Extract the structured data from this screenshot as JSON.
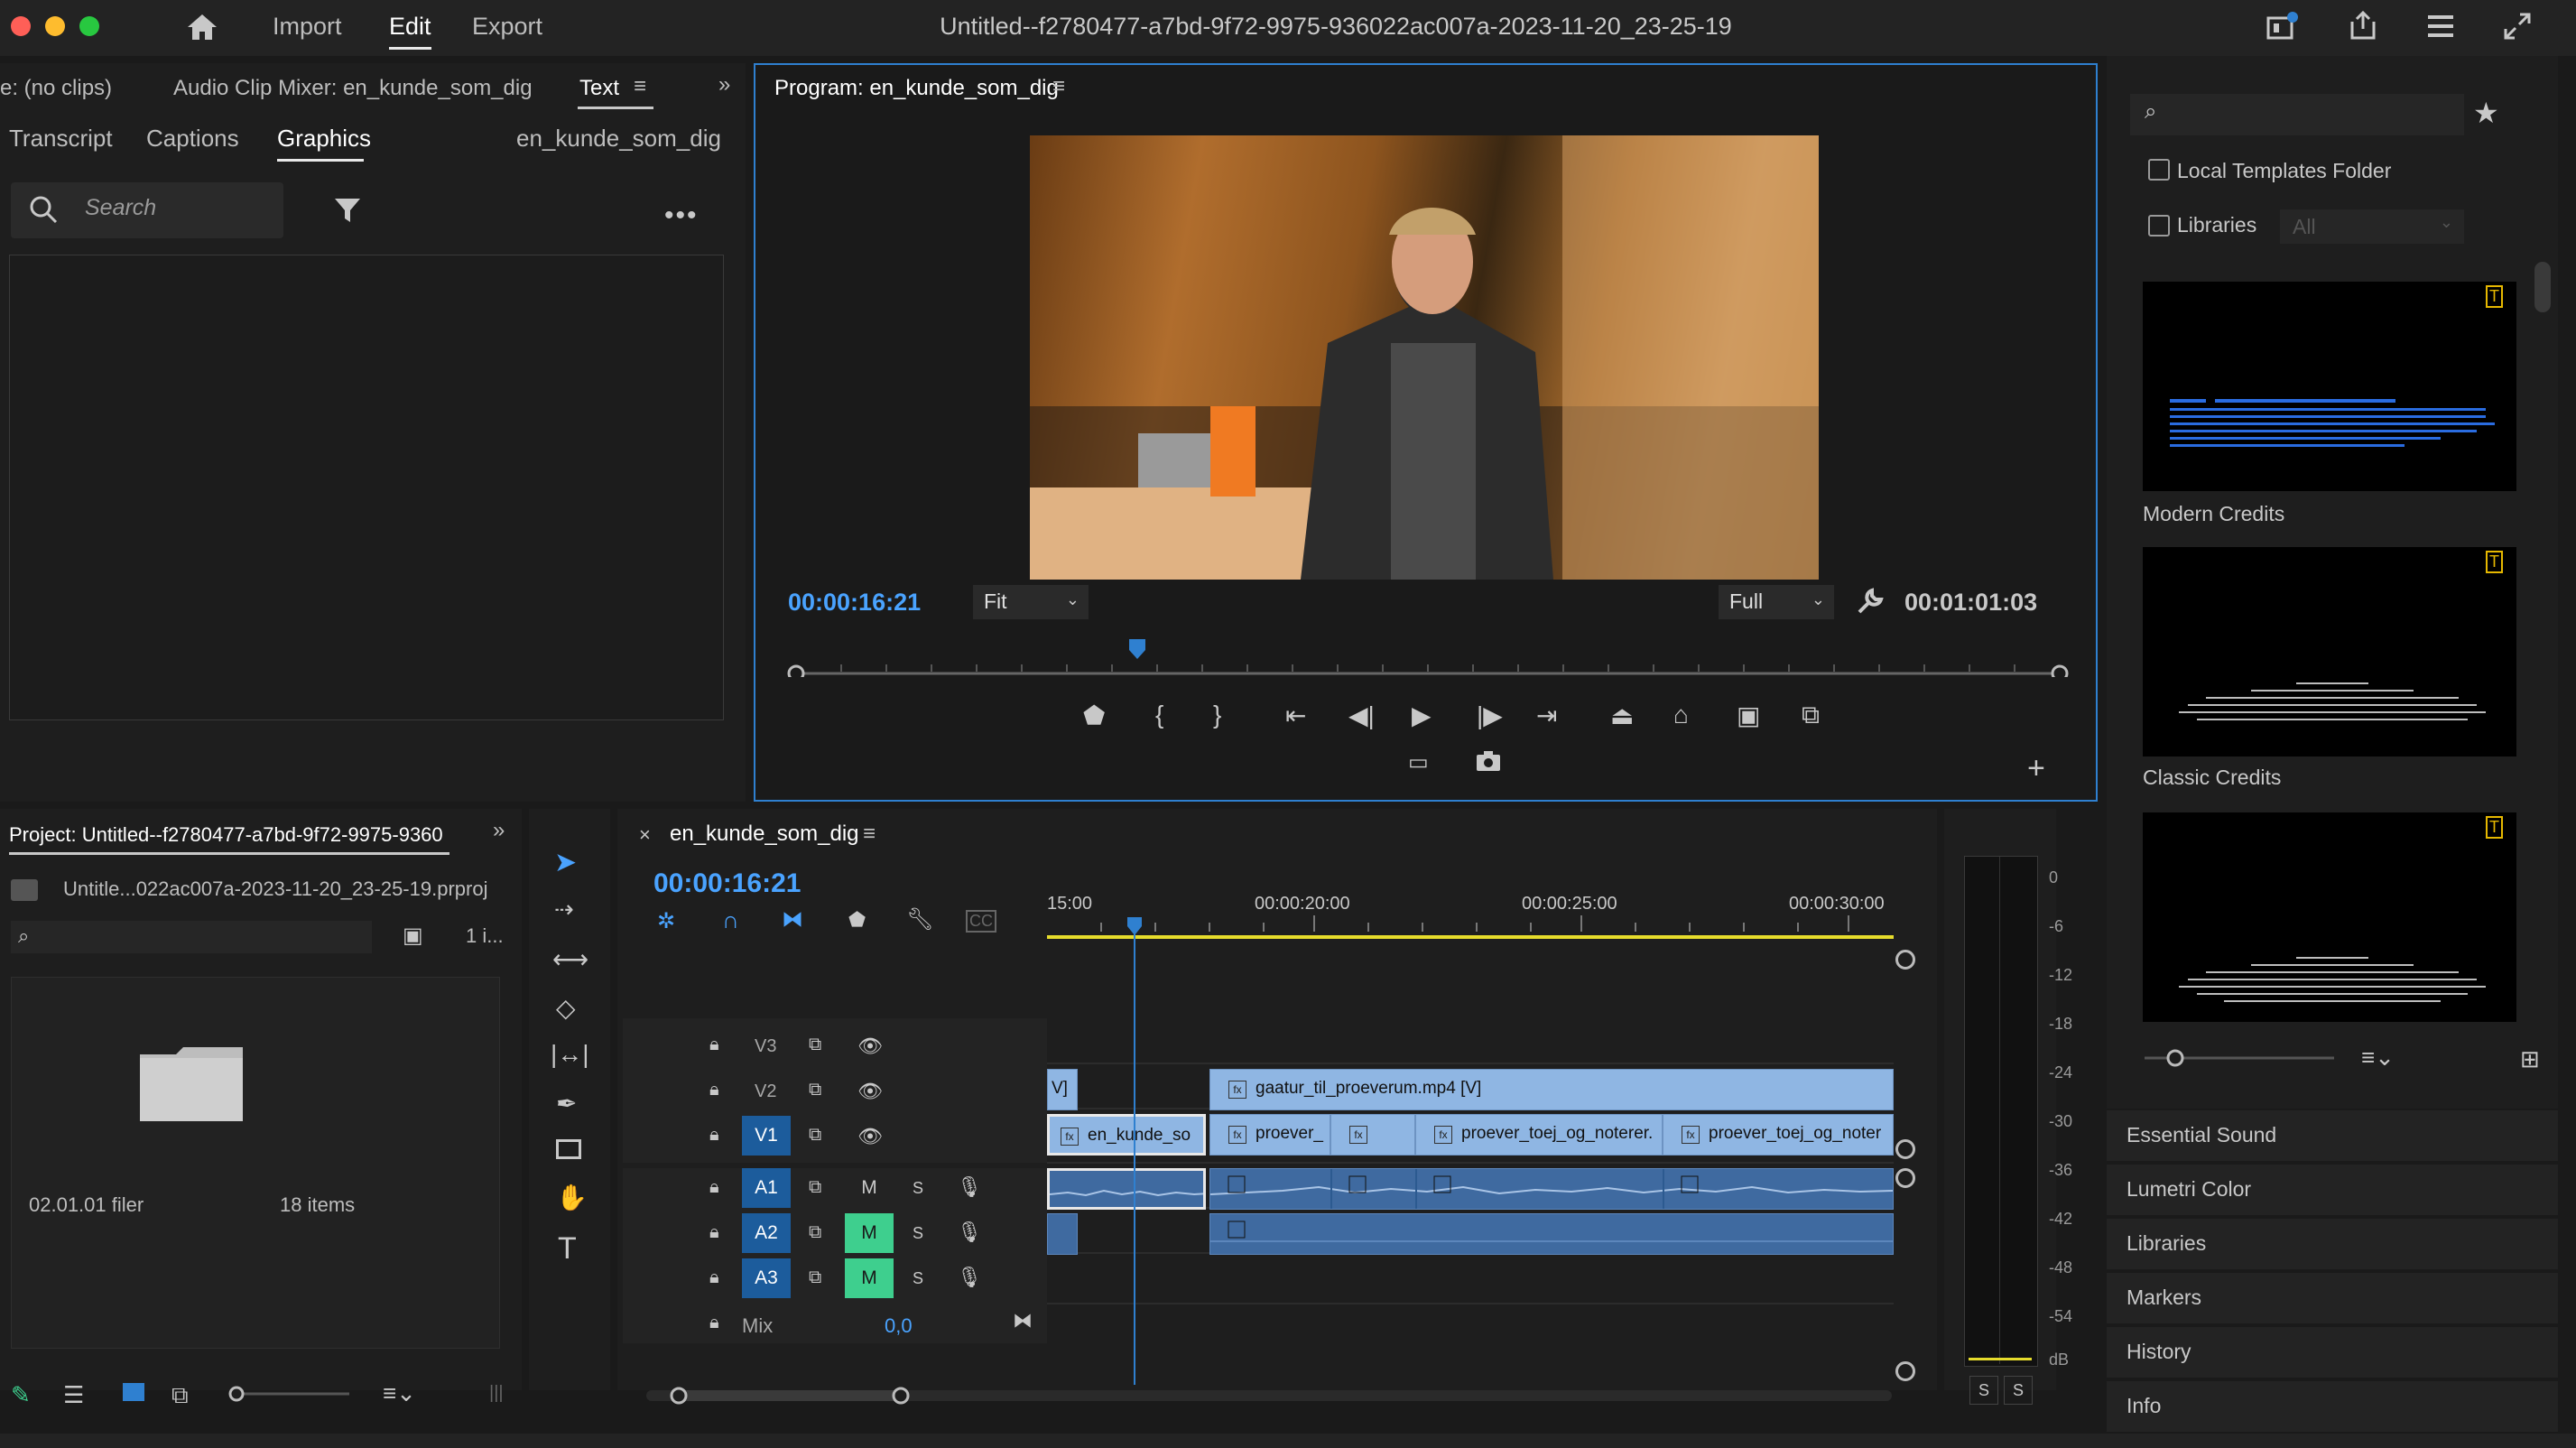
{
  "topbar": {
    "home_icon": "home-icon",
    "nav": [
      "Import",
      "Edit",
      "Export"
    ],
    "title": "Untitled--f2780477-a7bd-9f72-9975-936022ac007a-2023-11-20_23-25-19"
  },
  "left_panel": {
    "tabs": [
      "e: (no clips)",
      "Audio Clip Mixer: en_kunde_som_dig",
      "Text"
    ],
    "subtabs": [
      "Transcript",
      "Captions",
      "Graphics"
    ],
    "sequence_label": "en_kunde_som_dig",
    "search_placeholder": "Search"
  },
  "program_monitor": {
    "title": "Program: en_kunde_som_dig",
    "current_time": "00:00:16:21",
    "fit": "Fit",
    "quality": "Full",
    "duration": "00:01:01:03",
    "playhead_fraction": 0.27
  },
  "project": {
    "title": "Project: Untitled--f2780477-a7bd-9f72-9975-9360",
    "file": "Untitle...022ac007a-2023-11-20_23-25-19.prproj",
    "count_label": "1 i...",
    "bin_name": "02.01.01 filer",
    "bin_items": "18 items"
  },
  "timeline": {
    "sequence_name": "en_kunde_som_dig",
    "timecode": "00:00:16:21",
    "ruler": [
      "15:00",
      "00:00:20:00",
      "00:00:25:00",
      "00:00:30:00"
    ],
    "tracks_video": [
      "V3",
      "V2",
      "V1"
    ],
    "tracks_audio": [
      "A1",
      "A2",
      "A3"
    ],
    "mix_label": "Mix",
    "mix_value": "0,0",
    "clips": {
      "v2_left": "V]",
      "v2_main": "gaatur_til_proeverum.mp4 [V]",
      "v1_1": "en_kunde_so",
      "v1_2": "proever_",
      "v1_3": "proever_toej_og_noterer.",
      "v1_4": "proever_toej_og_noter"
    },
    "m_label": "M",
    "s_label": "S"
  },
  "meter": {
    "scale": [
      "0",
      "-6",
      "-12",
      "-18",
      "-24",
      "-30",
      "-36",
      "-42",
      "-48",
      "-54",
      "dB"
    ],
    "buttons": [
      "S",
      "S"
    ]
  },
  "essential_graphics": {
    "local_templates": "Local Templates Folder",
    "libraries": "Libraries",
    "libraries_select": "All",
    "templates": [
      "Modern Credits",
      "Classic Credits"
    ]
  },
  "panels_list": [
    "Essential Sound",
    "Lumetri Color",
    "Libraries",
    "Markers",
    "History",
    "Info"
  ],
  "colors": {
    "accent_blue": "#4aa3ff",
    "video_clip": "#8fb6e3",
    "audio_clip": "#3f6aa0",
    "active_track": "#1c5c9c",
    "mute_active": "#3ecf8e",
    "work_area": "#e6dc2c"
  }
}
